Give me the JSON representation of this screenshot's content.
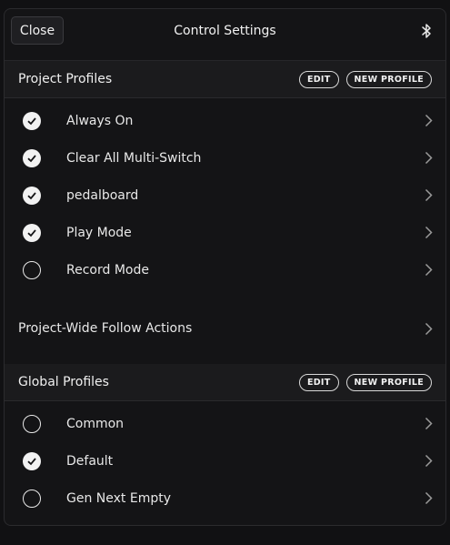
{
  "header": {
    "close_label": "Close",
    "title": "Control Settings",
    "bluetooth_icon": "bluetooth-icon"
  },
  "project_profiles": {
    "title": "Project Profiles",
    "edit_label": "EDIT",
    "new_label": "NEW PROFILE",
    "items": [
      {
        "label": "Always On",
        "checked": true
      },
      {
        "label": "Clear All Multi-Switch",
        "checked": true
      },
      {
        "label": "pedalboard",
        "checked": true
      },
      {
        "label": "Play Mode",
        "checked": true
      },
      {
        "label": "Record Mode",
        "checked": false
      }
    ]
  },
  "follow_actions": {
    "label": "Project-Wide Follow Actions"
  },
  "global_profiles": {
    "title": "Global Profiles",
    "edit_label": "EDIT",
    "new_label": "NEW PROFILE",
    "items": [
      {
        "label": "Common",
        "checked": false
      },
      {
        "label": "Default",
        "checked": true
      },
      {
        "label": "Gen Next Empty",
        "checked": false
      }
    ]
  },
  "colors": {
    "background": "#141416",
    "section_header": "#1b1b1d",
    "text": "#e8e8e8"
  }
}
